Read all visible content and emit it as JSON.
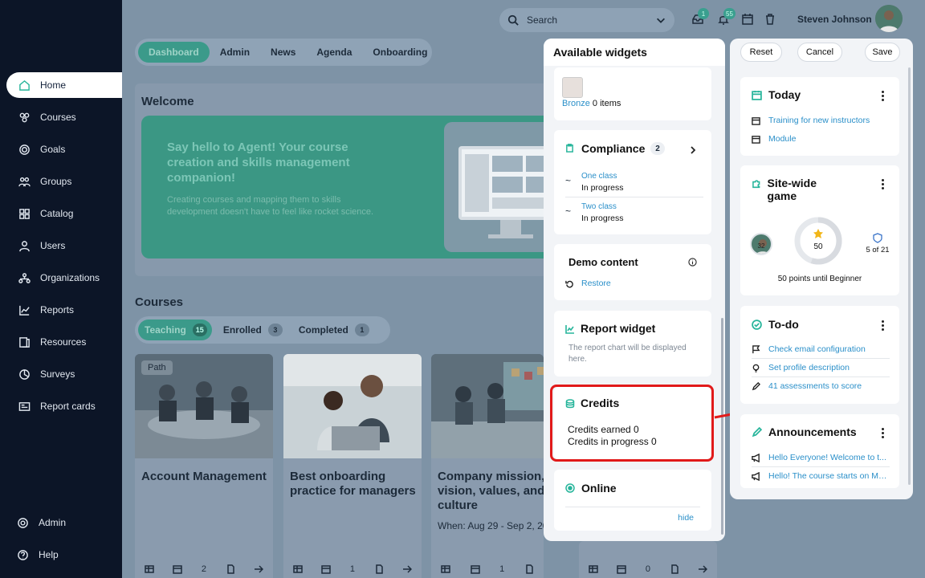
{
  "sidebar": {
    "items": [
      {
        "label": "Home",
        "icon": "home-icon"
      },
      {
        "label": "Courses",
        "icon": "courses-icon"
      },
      {
        "label": "Goals",
        "icon": "target-icon"
      },
      {
        "label": "Groups",
        "icon": "groups-icon"
      },
      {
        "label": "Catalog",
        "icon": "catalog-icon"
      },
      {
        "label": "Users",
        "icon": "user-icon"
      },
      {
        "label": "Organizations",
        "icon": "org-icon"
      },
      {
        "label": "Reports",
        "icon": "reports-icon"
      },
      {
        "label": "Resources",
        "icon": "resources-icon"
      },
      {
        "label": "Surveys",
        "icon": "surveys-icon"
      },
      {
        "label": "Report cards",
        "icon": "report-card-icon"
      }
    ],
    "bottom": [
      {
        "label": "Admin",
        "icon": "gear-icon"
      },
      {
        "label": "Help",
        "icon": "help-icon"
      }
    ]
  },
  "topbar": {
    "search_label": "Search",
    "inbox_badge": "1",
    "notif_badge": "55",
    "username": "Steven Johnson"
  },
  "main_tabs": [
    "Dashboard",
    "Admin",
    "News",
    "Agenda",
    "Onboarding"
  ],
  "welcome": {
    "title": "Welcome",
    "headline": "Say hello to Agent! Your course creation and skills management companion!",
    "subtext": "Creating courses and mapping them to skills development doesn't have to feel like rocket science."
  },
  "courses": {
    "title": "Courses",
    "tabs": [
      {
        "label": "Teaching",
        "count": "15"
      },
      {
        "label": "Enrolled",
        "count": "3"
      },
      {
        "label": "Completed",
        "count": "1"
      }
    ],
    "cards": [
      {
        "badge": "Path",
        "title": "Account Management",
        "date": "",
        "count": "2"
      },
      {
        "badge": "",
        "title": "Best onboarding practice for managers",
        "date": "",
        "count": "1"
      },
      {
        "badge": "",
        "title": "Company mission, vision, values, and culture",
        "date": "When: Aug 29 - Sep 2, 20",
        "count": "1"
      },
      {
        "badge": "",
        "title": "",
        "date": "",
        "count": "0"
      }
    ]
  },
  "available_widgets": {
    "title": "Available widgets",
    "bronze": {
      "label": "Bronze",
      "items": "0 items"
    },
    "compliance": {
      "title": "Compliance",
      "count": "2",
      "rows": [
        {
          "name": "One class",
          "status": "In progress"
        },
        {
          "name": "Two class",
          "status": "In progress"
        }
      ]
    },
    "demo": {
      "title": "Demo content",
      "action": "Restore"
    },
    "report": {
      "title": "Report widget",
      "text": "The report chart will be displayed here."
    },
    "credits": {
      "title": "Credits",
      "earned": "Credits earned 0",
      "in_progress": "Credits in progress 0"
    },
    "online": {
      "title": "Online",
      "action": "hide"
    }
  },
  "dashboard_panel": {
    "buttons": {
      "reset": "Reset",
      "cancel": "Cancel",
      "save": "Save"
    },
    "today": {
      "title": "Today",
      "items": [
        "Training for new instructors",
        "Module"
      ]
    },
    "game": {
      "title": "Site-wide game",
      "avatar_label": "32",
      "points": "50",
      "badge": "5 of 21",
      "caption": "50 points until Beginner",
      "progress": 0.55
    },
    "todo": {
      "title": "To-do",
      "items": [
        "Check email configuration",
        "Set profile description",
        "41 assessments to score"
      ]
    },
    "announcements": {
      "title": "Announcements",
      "items": [
        "Hello Everyone! Welcome to t...",
        "Hello! The course starts on Mo..."
      ]
    }
  },
  "colors": {
    "accent": "#27b59b",
    "link": "#2a8fc9",
    "highlight": "#e11a1a",
    "sidebar": "#0c1527"
  }
}
